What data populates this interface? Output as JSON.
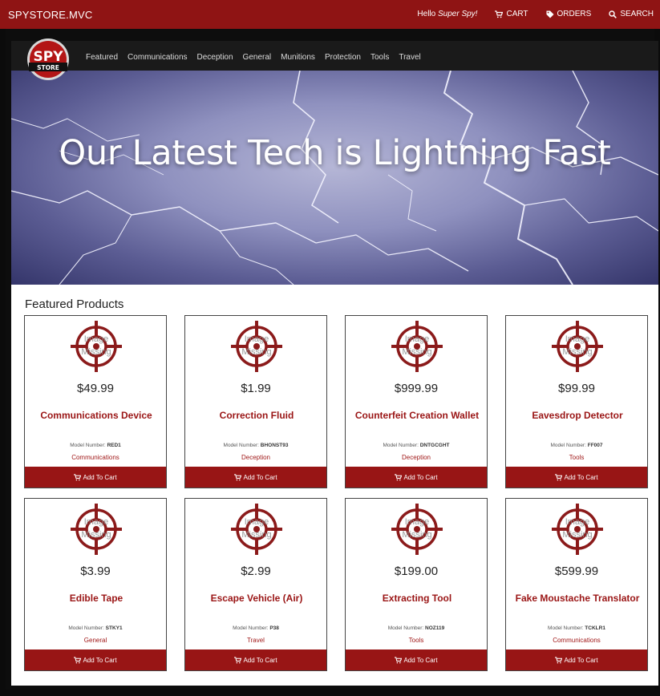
{
  "topbar": {
    "brand": "SPYSTORE.MVC",
    "hello_prefix": "Hello ",
    "hello_user": "Super Spy!",
    "cart": "CART",
    "orders": "ORDERS",
    "search": "SEARCH"
  },
  "logo": {
    "line1": "SPY",
    "line2": "STORE"
  },
  "nav": [
    "Featured",
    "Communications",
    "Deception",
    "General",
    "Munitions",
    "Protection",
    "Tools",
    "Travel"
  ],
  "hero": {
    "title": "Our Latest Tech is Lightning Fast"
  },
  "featured": {
    "title": "Featured Products",
    "image_missing_text": [
      "Image",
      "Missing"
    ],
    "model_label": "Model Number: ",
    "add_label": "Add To Cart",
    "products": [
      {
        "price": "$49.99",
        "name": "Communications Device",
        "model": "RED1",
        "category": "Communications"
      },
      {
        "price": "$1.99",
        "name": "Correction Fluid",
        "model": "BHONST93",
        "category": "Deception"
      },
      {
        "price": "$999.99",
        "name": "Counterfeit Creation Wallet",
        "model": "DNTGCGHT",
        "category": "Deception"
      },
      {
        "price": "$99.99",
        "name": "Eavesdrop Detector",
        "model": "FF007",
        "category": "Tools"
      },
      {
        "price": "$3.99",
        "name": "Edible Tape",
        "model": "STKY1",
        "category": "General"
      },
      {
        "price": "$2.99",
        "name": "Escape Vehicle (Air)",
        "model": "P38",
        "category": "Travel"
      },
      {
        "price": "$199.00",
        "name": "Extracting Tool",
        "model": "NOZ119",
        "category": "Tools"
      },
      {
        "price": "$599.99",
        "name": "Fake Moustache Translator",
        "model": "TCKLR1",
        "category": "Communications"
      }
    ]
  },
  "colors": {
    "brand_red": "#8f1414",
    "button_red": "#981515",
    "nav_dark": "#1a1a1a"
  }
}
